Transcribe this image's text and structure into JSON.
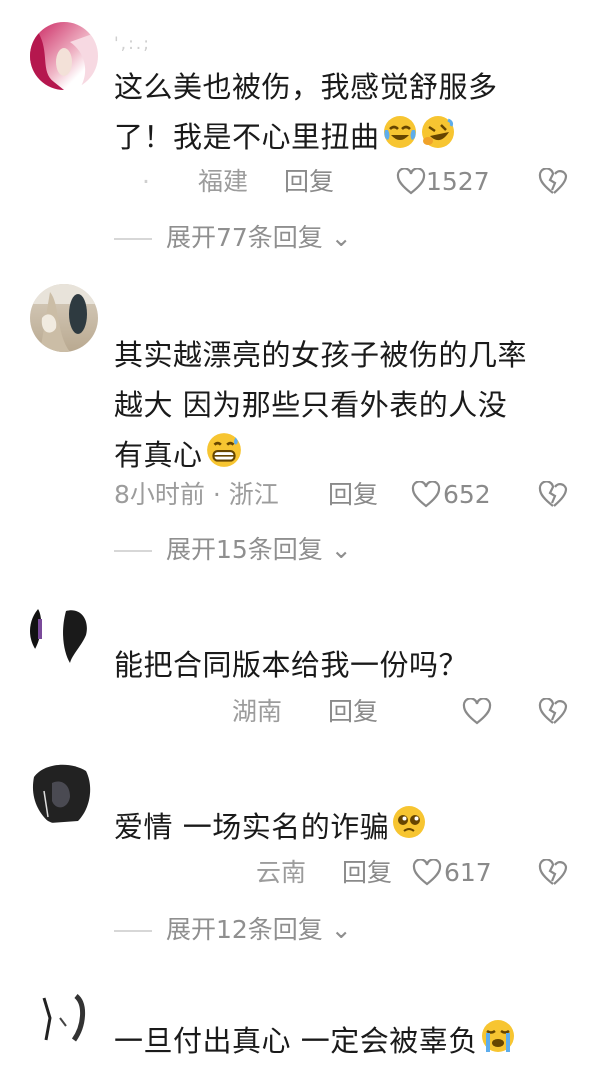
{
  "comments": [
    {
      "username": "',:.;",
      "text": [
        "这么美也被伤，我感觉舒服多",
        "了！我是不心里扭曲"
      ],
      "meta_prefix": "·",
      "location": "福建",
      "reply": "回复",
      "likes": "1527",
      "expand": "展开77条回复",
      "emojis": [
        "crying-laughing-emoji",
        "rofl-emoji"
      ]
    },
    {
      "username": "",
      "text": [
        "其实越漂亮的女孩子被伤的几率",
        "越大 因为那些只看外表的人没",
        "有真心"
      ],
      "time": "8小时前 · 浙江",
      "reply": "回复",
      "likes": "652",
      "expand": "展开15条回复",
      "emojis": [
        "grin-sweat-emoji"
      ]
    },
    {
      "username": "",
      "text": [
        "能把合同版本给我一份吗？"
      ],
      "meta_prefix": "湖南",
      "reply": "回复",
      "likes": "",
      "expand": ""
    },
    {
      "username": "",
      "text": [
        "爱情 一场实名的诈骗"
      ],
      "location": "云南",
      "reply": "回复",
      "likes": "617",
      "expand": "展开12条回复",
      "emojis": [
        "pleading-emoji"
      ]
    },
    {
      "username": "",
      "text": [
        "一旦付出真心 一定会被辜负"
      ],
      "emojis": [
        "loudly-crying-emoji"
      ]
    }
  ],
  "colors": {
    "text": "#1a1a1a",
    "meta": "#9c9c9c",
    "icon": "#8a8a8a"
  }
}
